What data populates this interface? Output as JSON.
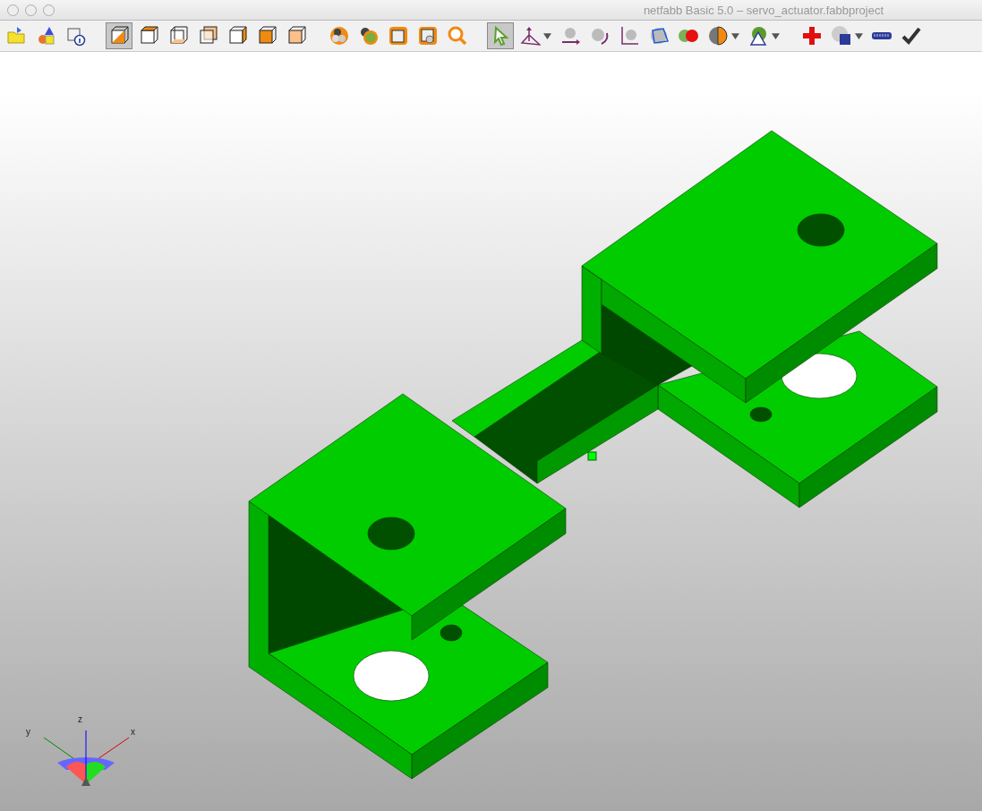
{
  "window": {
    "title": "netfabb Basic 5.0 – servo_actuator.fabbproject"
  },
  "toolbar": {
    "groups": [
      [
        {
          "selected": false,
          "dropdown": false
        },
        {
          "selected": false,
          "dropdown": false
        },
        {
          "selected": false,
          "dropdown": false
        }
      ],
      [
        {
          "selected": true,
          "dropdown": false
        },
        {
          "selected": false,
          "dropdown": false
        },
        {
          "selected": false,
          "dropdown": false
        },
        {
          "selected": false,
          "dropdown": false
        },
        {
          "selected": false,
          "dropdown": false
        },
        {
          "selected": false,
          "dropdown": false
        },
        {
          "selected": false,
          "dropdown": false
        }
      ],
      [
        {
          "selected": false,
          "dropdown": false
        },
        {
          "selected": false,
          "dropdown": false
        },
        {
          "selected": false,
          "dropdown": false
        },
        {
          "selected": false,
          "dropdown": false
        },
        {
          "selected": false,
          "dropdown": false
        }
      ],
      [
        {
          "selected": true,
          "dropdown": false
        },
        {
          "selected": false,
          "dropdown": true
        },
        {
          "selected": false,
          "dropdown": false
        },
        {
          "selected": false,
          "dropdown": false
        },
        {
          "selected": false,
          "dropdown": false
        },
        {
          "selected": false,
          "dropdown": false
        },
        {
          "selected": false,
          "dropdown": false
        },
        {
          "selected": false,
          "dropdown": true
        },
        {
          "selected": false,
          "dropdown": true
        }
      ],
      [
        {
          "selected": false,
          "dropdown": false
        },
        {
          "selected": false,
          "dropdown": true
        },
        {
          "selected": false,
          "dropdown": false
        },
        {
          "selected": false,
          "dropdown": false
        }
      ]
    ]
  },
  "axes": {
    "y_label": "y",
    "z_label": "z",
    "x_label": "x"
  }
}
